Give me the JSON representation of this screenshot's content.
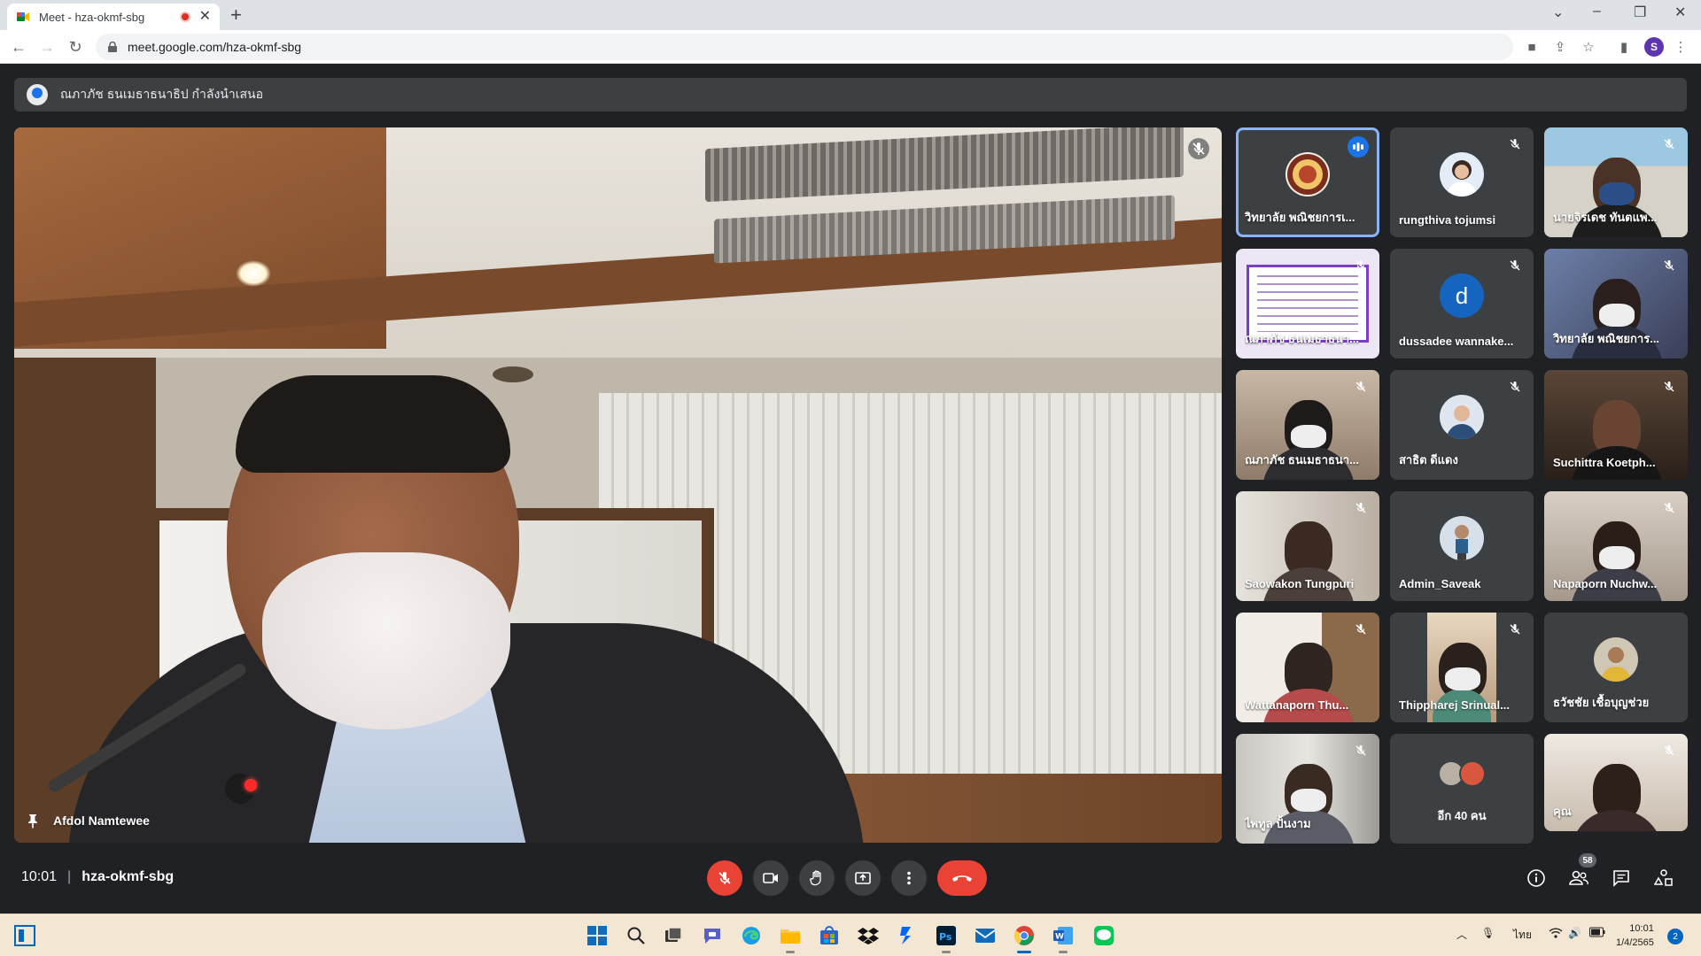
{
  "browser": {
    "tab_title": "Meet - hza-okmf-sbg",
    "new_tab_label": "+",
    "url": "meet.google.com/hza-okmf-sbg",
    "profile_initial": "S"
  },
  "meet": {
    "presenting_text": "ณภาภัช ธนเมธาธนาธิป กำลังนำเสนอ",
    "main_speaker": "Afdol Namtewee",
    "time": "10:01",
    "meeting_code": "hza-okmf-sbg",
    "participant_count": "58",
    "participants": [
      {
        "name": "วิทยาลัย พณิชยการเ...",
        "kind": "logo",
        "speaking": true
      },
      {
        "name": "rungthiva tojumsi",
        "kind": "avatar"
      },
      {
        "name": "นายจิรเดช ทันตแพ...",
        "kind": "video"
      },
      {
        "name": "ณภาภัช ธนเมธาธนา...",
        "kind": "slide"
      },
      {
        "name": "dussadee wannake...",
        "kind": "letter",
        "letter": "d"
      },
      {
        "name": "วิทยาลัย พณิชยการ...",
        "kind": "video"
      },
      {
        "name": "ณภาภัช ธนเมธาธนา...",
        "kind": "video"
      },
      {
        "name": "สาธิต ดีแดง",
        "kind": "avatar"
      },
      {
        "name": "Suchittra Koetph...",
        "kind": "video"
      },
      {
        "name": "Saowakon Tungpuri",
        "kind": "video"
      },
      {
        "name": "Admin_Saveak",
        "kind": "avatar"
      },
      {
        "name": "Napaporn Nuchw...",
        "kind": "video"
      },
      {
        "name": "Wattanaporn Thu...",
        "kind": "video"
      },
      {
        "name": "Thippharej Srinual...",
        "kind": "video"
      },
      {
        "name": "ธวัชชัย เชื้อบุญช่วย",
        "kind": "avatar"
      },
      {
        "name": "ไพทูล ปั้นงาม",
        "kind": "video"
      },
      {
        "name": "อีก 40 คน",
        "kind": "more"
      },
      {
        "name": "คุณ",
        "kind": "video"
      }
    ]
  },
  "taskbar": {
    "lang": "ไทย",
    "clock_time": "10:01",
    "clock_date": "1/4/2565",
    "notifications": "2"
  },
  "colors": {
    "meet_bg": "#202124",
    "tile_bg": "#3c4043",
    "end_call": "#ea4335",
    "accent": "#8ab4f8"
  }
}
